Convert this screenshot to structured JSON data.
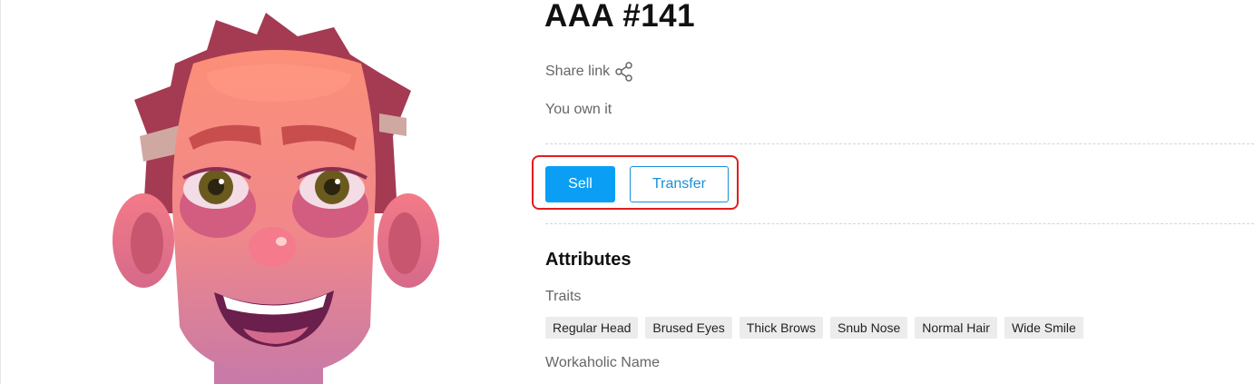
{
  "nft": {
    "title": "AAA #141",
    "share_label": "Share link",
    "ownership": "You own it",
    "avatar_icon": "cartoon-face-avatar"
  },
  "actions": {
    "sell_label": "Sell",
    "transfer_label": "Transfer"
  },
  "attributes": {
    "heading": "Attributes",
    "traits_label": "Traits",
    "traits": [
      "Regular Head",
      "Brused Eyes",
      "Thick Brows",
      "Snub Nose",
      "Normal Hair",
      "Wide Smile"
    ],
    "next_label": "Workaholic Name"
  },
  "colors": {
    "primary": "#0a9ff5",
    "highlight": "#e21d1d",
    "chip_bg": "#ececec",
    "muted_text": "#666666"
  }
}
